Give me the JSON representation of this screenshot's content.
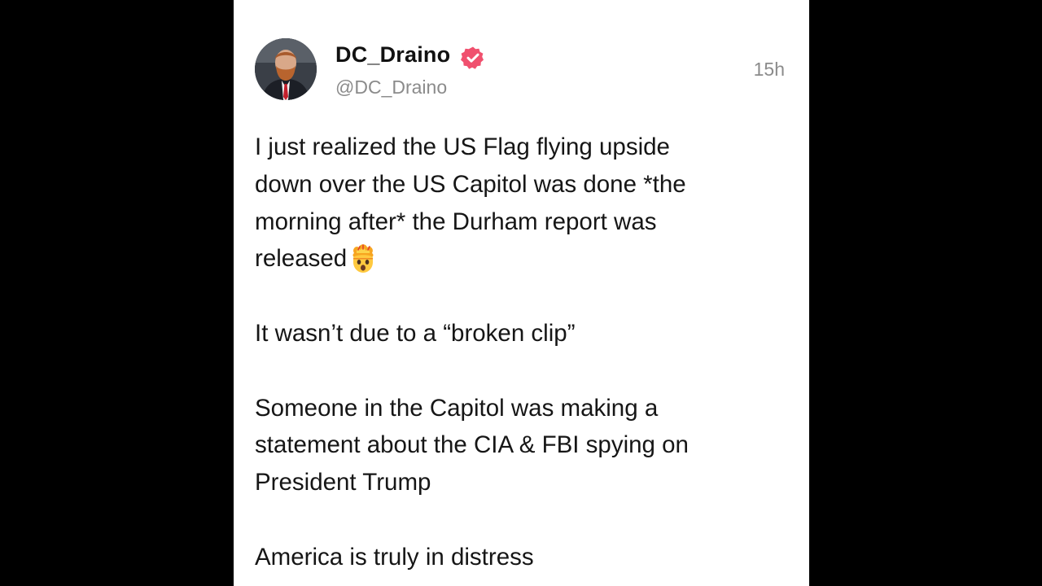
{
  "post": {
    "author": {
      "display_name": "DC_Draino",
      "handle": "@DC_Draino",
      "verified_badge": "verified-check-icon",
      "avatar": "avatar-photo"
    },
    "timestamp": "15h",
    "paragraphs": [
      "I just realized the US Flag flying upside\ndown over the US Capitol was done *the\nmorning after* the Durham report was\nreleased",
      "It wasn’t due to a “broken clip”",
      "Someone in the Capitol was making a\nstatement about the CIA & FBI spying on\nPresident Trump",
      "America is truly in distress"
    ],
    "emoji": "exploding-head-emoji"
  },
  "colors": {
    "background": "#000000",
    "card": "#ffffff",
    "text": "#161616",
    "muted": "#8b8b8b",
    "verified_badge": "#f0506e"
  }
}
